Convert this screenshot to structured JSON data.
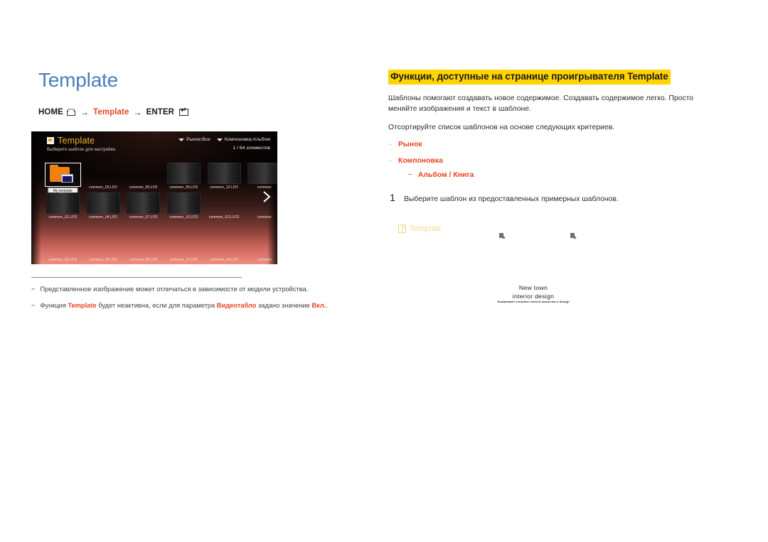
{
  "page": {
    "title": "Template",
    "breadcrumb": {
      "home": "HOME",
      "home_icon": "home-icon",
      "arrow1": "→",
      "target": "Template",
      "arrow2": "→",
      "enter": "ENTER",
      "enter_icon": "enter-key-icon"
    }
  },
  "tv": {
    "title": "Template",
    "title_icon": "template-icon",
    "subtitle": "Выберите шаблон для настройки.",
    "filters": [
      {
        "label": "Рынок:Все",
        "icon": "chevron-down-icon"
      },
      {
        "label": "Компоновка:Альбом",
        "icon": "chevron-down-icon"
      }
    ],
    "count": "1 / 64 элементов",
    "selected_label": "My template",
    "next_icon": "chevron-right-icon",
    "grid": {
      "row1": [
        "",
        "common_03.LFD",
        "common_06.LFD",
        "common_09.LFD",
        "common_12.LFD",
        "common"
      ],
      "row2": [
        "common_01.LFD",
        "common_04.LFD",
        "common_07.LFD",
        "common_10.LFD",
        "common_013.LFD",
        "common"
      ],
      "row3": [
        "common_02.LFD",
        "common_05.LFD",
        "common_08.LFD",
        "common_11.LFD",
        "common_14.LFD",
        "common"
      ]
    }
  },
  "notes": [
    {
      "dash": "−",
      "parts": [
        {
          "text": "Представленное изображение может отличаться в зависимости от модели устройства.",
          "accent": false
        }
      ]
    },
    {
      "dash": "−",
      "parts": [
        {
          "text": "Функция ",
          "accent": false
        },
        {
          "text": "Template",
          "accent": true
        },
        {
          "text": " будет неактивна, если для параметра ",
          "accent": false
        },
        {
          "text": "Видеотабло",
          "accent": true
        },
        {
          "text": " задано значение ",
          "accent": false
        },
        {
          "text": "Вкл.",
          "accent": true
        },
        {
          "text": ".",
          "accent": false
        }
      ]
    }
  ],
  "right": {
    "section_title": "Функции, доступные на странице проигрывателя Template",
    "paragraph1": "Шаблоны помогают создавать новое содержимое. Создавать содержимое легко. Просто меняйте изображения и текст в шаблоне.",
    "paragraph2": "Отсортируйте список шаблонов на основе следующих критериев.",
    "bullets": [
      {
        "dot": "·",
        "label": "Рынок"
      },
      {
        "dot": "·",
        "label": "Компоновка"
      }
    ],
    "subbullet": {
      "dash": "−",
      "label": "Альбом / Книга"
    },
    "step": {
      "num": "1",
      "text": "Выберите шаблон из предоставленных примерных шаблонов."
    },
    "template_tag": {
      "icon": "layout-template-icon",
      "label": "Template"
    }
  },
  "preview": {
    "line1": "New town",
    "line2": "interior design",
    "tagline": "Sustainable evolution unlock tomorrow s design",
    "icon1": "image-placeholder-icon",
    "icon2": "image-placeholder-icon"
  },
  "colors": {
    "title_blue": "#4a7ebb",
    "accent_red": "#e8431f",
    "highlight_yellow": "#ffd400",
    "tv_gold": "#f2b233",
    "tag_gold": "#f5d98a"
  }
}
